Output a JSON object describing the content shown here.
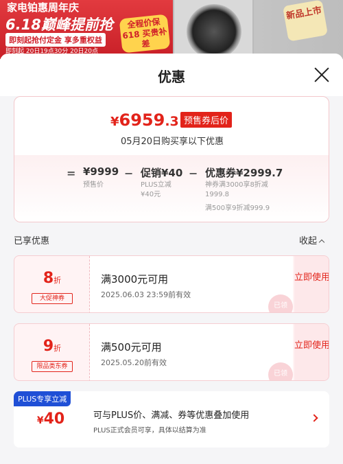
{
  "banner": {
    "line1": "家电铂惠周年庆",
    "line2": "6.18巅峰提前抢",
    "line3": "即刻起抢付定金 享多重权益",
    "line4": "即刻起 20日19点30分 20日20点",
    "badge": "全程价保 618 买贵补差",
    "new_badge": "新品上市"
  },
  "sheet": {
    "title": "优惠"
  },
  "summary": {
    "currency": "¥",
    "final_int": "6959",
    "final_dec": ".3",
    "presale_label": "预售券后价",
    "date_line": "05月20日购买享以下优惠",
    "eq": "=",
    "presale_price": "¥9999",
    "presale_price_label": "预售价",
    "minus": "−",
    "promo": "促销¥40",
    "promo_sub1": "PLUS立减",
    "promo_sub2": "¥40元",
    "coupon_total": "优惠券¥2999.7",
    "coupon_sub1": "神券满3000享8折减",
    "coupon_sub2": "1999.8",
    "coupon_sub3": "满500享9折减999.9"
  },
  "enjoyed": {
    "label": "已享优惠",
    "collapse": "收起"
  },
  "coupons": [
    {
      "discount": "8",
      "unit": "折",
      "tag": "大促神券",
      "condition": "满3000元可用",
      "valid": "2025.06.03 23:59前有效",
      "use": "立即使用",
      "stamp": "已领"
    },
    {
      "discount": "9",
      "unit": "折",
      "tag": "限品类东券",
      "condition": "满500元可用",
      "valid": "2025.05.20前有效",
      "use": "立即使用",
      "stamp": "已领"
    }
  ],
  "plus": {
    "tag": "PLUS专享立减",
    "currency": "¥",
    "amount": "40",
    "line1": "可与PLUS价、满减、券等优惠叠加使用",
    "line2": "PLUS正式会员可享，具体以结算为准"
  },
  "colors": {
    "accent": "#e2231a",
    "plus_blue": "#1f4fd6"
  }
}
